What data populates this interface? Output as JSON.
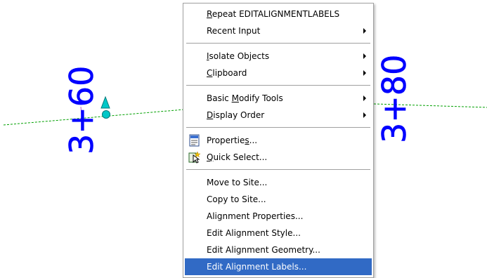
{
  "drawing": {
    "left_station_label": "3+60",
    "right_station_label": "3+80",
    "label_color": "#0000ff",
    "alignment_line_color": "#00a000",
    "grip_color": "#00c8c8"
  },
  "context_menu": {
    "highlight_color": "#316ac5",
    "items": {
      "repeat": {
        "label": "Repeat EDITALIGNMENTLABELS",
        "mnemonic": "R"
      },
      "recent_input": {
        "label": "Recent Input"
      },
      "isolate_objects": {
        "label": "Isolate Objects",
        "mnemonic": "I"
      },
      "clipboard": {
        "label": "Clipboard",
        "mnemonic": "C"
      },
      "basic_modify_tools": {
        "label": "Basic Modify Tools",
        "mnemonic": "M"
      },
      "display_order": {
        "label": "Display Order",
        "mnemonic": "D"
      },
      "properties": {
        "label": "Properties...",
        "mnemonic": "s",
        "icon": "properties-icon"
      },
      "quick_select": {
        "label": "Quick Select...",
        "mnemonic": "Q",
        "icon": "quick-select-icon"
      },
      "move_to_site": {
        "label": "Move to Site..."
      },
      "copy_to_site": {
        "label": "Copy to Site..."
      },
      "alignment_properties": {
        "label": "Alignment Properties..."
      },
      "edit_alignment_style": {
        "label": "Edit Alignment Style..."
      },
      "edit_alignment_geometry": {
        "label": "Edit Alignment Geometry..."
      },
      "edit_alignment_labels": {
        "label": "Edit Alignment Labels..."
      }
    }
  }
}
